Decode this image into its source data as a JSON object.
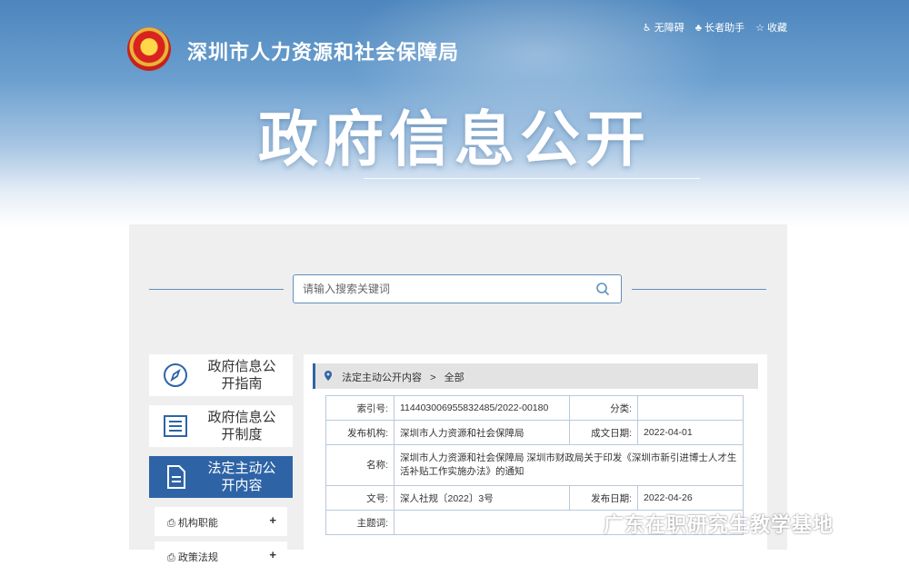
{
  "header": {
    "site_name": "深圳市人力资源和社会保障局",
    "utilities": [
      "无障碍",
      "长者助手",
      "收藏"
    ],
    "big_title": "政府信息公开"
  },
  "search": {
    "placeholder": "请输入搜索关键词"
  },
  "menu": {
    "items": [
      {
        "label": "政府信息公开指南",
        "icon": "compass-icon"
      },
      {
        "label": "政府信息公开制度",
        "icon": "list-icon"
      },
      {
        "label": "法定主动公开内容",
        "icon": "document-icon"
      }
    ],
    "subitems": [
      {
        "label": "机构职能",
        "icon": "org-icon",
        "expand": "+"
      },
      {
        "label": "政策法规",
        "icon": "doc-icon",
        "expand": "+"
      }
    ]
  },
  "breadcrumb": {
    "section": "法定主动公开内容",
    "separator": ">",
    "current": "全部"
  },
  "info": {
    "index_label": "索引号:",
    "index_value": "11440300695583248​5/2022-00180",
    "category_label": "分类:",
    "category_value": "",
    "publisher_label": "发布机构:",
    "publisher_value": "深圳市人力资源和社会保障局",
    "written_label": "成文日期:",
    "written_value": "2022-04-01",
    "name_label": "名称:",
    "name_value": "深圳市人力资源和社会保障局 深圳市财政局关于印发《深圳市新引进博士人才生活补贴工作实施办法》的通知",
    "docno_label": "文号:",
    "docno_value": "深人社规〔2022〕3号",
    "pubdate_label": "发布日期:",
    "pubdate_value": "2022-04-26",
    "subject_label": "主题词:",
    "subject_value": ""
  },
  "watermark": "广东在职研究生教学基地"
}
